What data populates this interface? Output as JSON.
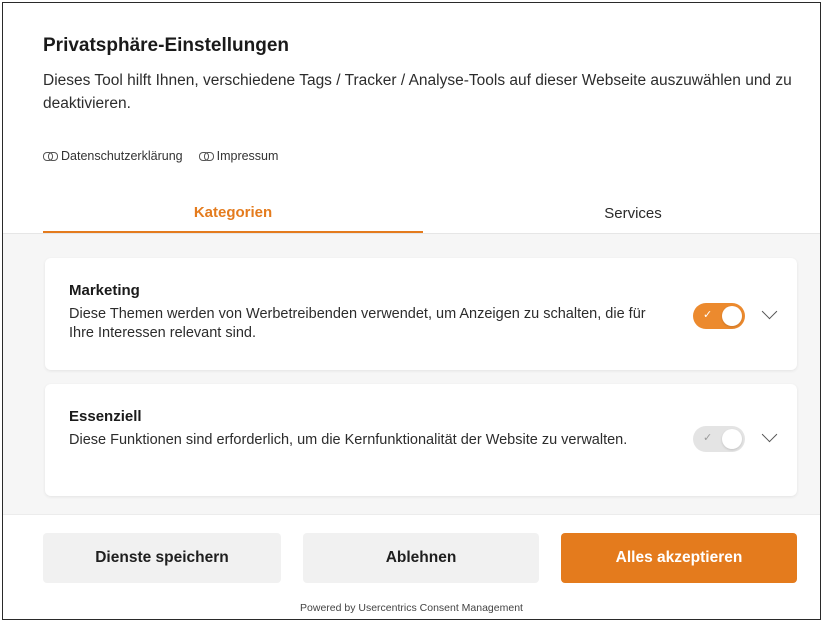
{
  "header": {
    "title": "Privatsphäre-Einstellungen",
    "description": "Dieses Tool hilft Ihnen, verschiedene Tags / Tracker / Analyse-Tools auf dieser Webseite auszuwählen und zu deaktivieren."
  },
  "links": [
    {
      "label": "Datenschutzerklärung",
      "icon": "link-icon"
    },
    {
      "label": "Impressum",
      "icon": "link-icon"
    }
  ],
  "tabs": [
    {
      "label": "Kategorien",
      "active": true
    },
    {
      "label": "Services",
      "active": false
    }
  ],
  "categories": [
    {
      "title": "Marketing",
      "text": "Diese Themen werden von Werbetreibenden verwendet, um Anzeigen zu schalten, die für Ihre Interessen relevant sind.",
      "enabled": true,
      "toggle_icon": "✓"
    },
    {
      "title": "Essenziell",
      "text": "Diese Funktionen sind erforderlich, um die Kernfunktionalität der Website zu verwalten.",
      "enabled": true,
      "disabled_toggle": true,
      "toggle_icon": "✓"
    }
  ],
  "buttons": {
    "save": "Dienste speichern",
    "deny": "Ablehnen",
    "accept": "Alles akzeptieren"
  },
  "footer": {
    "powered_by": "Powered by Usercentrics Consent Management"
  },
  "colors": {
    "accent": "#e47b1d",
    "toggle_on": "#ec8a2e",
    "toggle_disabled": "#e4e4e4",
    "button_secondary": "#f1f1f1"
  }
}
